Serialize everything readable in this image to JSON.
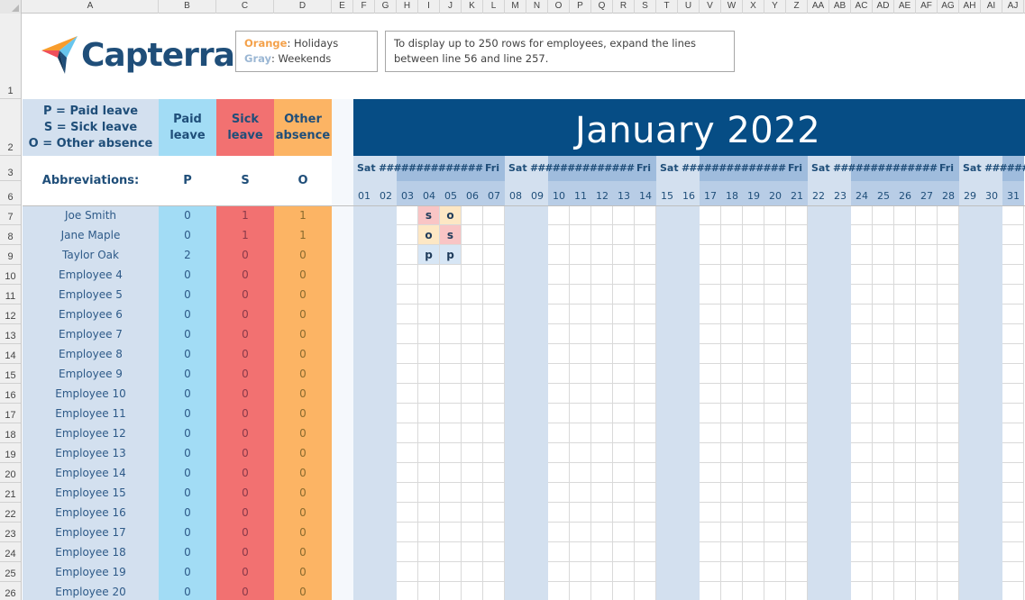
{
  "spreadsheet": {
    "columns": [
      "A",
      "B",
      "C",
      "D",
      "E",
      "F",
      "G",
      "H",
      "I",
      "J",
      "K",
      "L",
      "M",
      "N",
      "O",
      "P",
      "Q",
      "R",
      "S",
      "T",
      "U",
      "V",
      "W",
      "X",
      "Y",
      "Z",
      "AA",
      "AB",
      "AC",
      "AD",
      "AE",
      "AF",
      "AG",
      "AH",
      "AI",
      "AJ"
    ],
    "row_numbers": [
      "1",
      "2",
      "3",
      "6",
      "7",
      "8",
      "9",
      "10",
      "11",
      "12",
      "13",
      "14",
      "15",
      "16",
      "17",
      "18",
      "19",
      "20",
      "21",
      "22",
      "23",
      "24",
      "25",
      "26"
    ]
  },
  "logo": {
    "text": "Capterra",
    "colors": {
      "orange": "#f89c2c",
      "red": "#ef4f5a",
      "blue": "#68c5ed",
      "navy": "#1f4e79"
    }
  },
  "legend": {
    "orange_label": "Orange",
    "orange_desc": ": Holidays",
    "gray_label": "Gray",
    "gray_desc": ": Weekends"
  },
  "note": {
    "line1": "To display up to 250 rows for employees, expand the lines",
    "line2": "between line 56 and line 257."
  },
  "key": {
    "line1": "P = Paid leave",
    "line2": "S = Sick leave",
    "line3": "O = Other absence"
  },
  "summary_headers": {
    "paid": [
      "Paid",
      "leave"
    ],
    "sick": [
      "Sick",
      "leave"
    ],
    "other": [
      "Other",
      "absence"
    ]
  },
  "abbreviations": {
    "label": "Abbreviations:",
    "paid": "P",
    "sick": "S",
    "other": "O"
  },
  "calendar": {
    "title": "January 2022",
    "weekday_labels": {
      "sat": "Sat",
      "fri": "Fri",
      "overflow": "##############"
    },
    "days": [
      "01",
      "02",
      "03",
      "04",
      "05",
      "06",
      "07",
      "08",
      "09",
      "10",
      "11",
      "12",
      "13",
      "14",
      "15",
      "16",
      "17",
      "18",
      "19",
      "20",
      "21",
      "22",
      "23",
      "24",
      "25",
      "26",
      "27",
      "28",
      "29",
      "30",
      "31"
    ],
    "weekend_days": [
      "01",
      "02",
      "08",
      "09",
      "15",
      "16",
      "22",
      "23",
      "29",
      "30"
    ],
    "colors": {
      "header": "#064d85",
      "weekend": "#d3e0ef",
      "weekday_band": "#9fbcdd",
      "sick": "#f9c5c5",
      "other": "#fde7c4",
      "paid": "#d7e6f5"
    }
  },
  "employees": [
    {
      "row": "7",
      "name": "Joe Smith",
      "paid": "0",
      "sick": "1",
      "other": "1",
      "marks": {
        "04": "s",
        "05": "o"
      }
    },
    {
      "row": "8",
      "name": "Jane Maple",
      "paid": "0",
      "sick": "1",
      "other": "1",
      "marks": {
        "04": "o",
        "05": "s"
      }
    },
    {
      "row": "9",
      "name": "Taylor Oak",
      "paid": "2",
      "sick": "0",
      "other": "0",
      "marks": {
        "04": "p",
        "05": "p"
      }
    },
    {
      "row": "10",
      "name": "Employee 4",
      "paid": "0",
      "sick": "0",
      "other": "0",
      "marks": {}
    },
    {
      "row": "11",
      "name": "Employee 5",
      "paid": "0",
      "sick": "0",
      "other": "0",
      "marks": {}
    },
    {
      "row": "12",
      "name": "Employee 6",
      "paid": "0",
      "sick": "0",
      "other": "0",
      "marks": {}
    },
    {
      "row": "13",
      "name": "Employee 7",
      "paid": "0",
      "sick": "0",
      "other": "0",
      "marks": {}
    },
    {
      "row": "14",
      "name": "Employee 8",
      "paid": "0",
      "sick": "0",
      "other": "0",
      "marks": {}
    },
    {
      "row": "15",
      "name": "Employee 9",
      "paid": "0",
      "sick": "0",
      "other": "0",
      "marks": {}
    },
    {
      "row": "16",
      "name": "Employee 10",
      "paid": "0",
      "sick": "0",
      "other": "0",
      "marks": {}
    },
    {
      "row": "17",
      "name": "Employee 11",
      "paid": "0",
      "sick": "0",
      "other": "0",
      "marks": {}
    },
    {
      "row": "18",
      "name": "Employee 12",
      "paid": "0",
      "sick": "0",
      "other": "0",
      "marks": {}
    },
    {
      "row": "19",
      "name": "Employee 13",
      "paid": "0",
      "sick": "0",
      "other": "0",
      "marks": {}
    },
    {
      "row": "20",
      "name": "Employee 14",
      "paid": "0",
      "sick": "0",
      "other": "0",
      "marks": {}
    },
    {
      "row": "21",
      "name": "Employee 15",
      "paid": "0",
      "sick": "0",
      "other": "0",
      "marks": {}
    },
    {
      "row": "22",
      "name": "Employee 16",
      "paid": "0",
      "sick": "0",
      "other": "0",
      "marks": {}
    },
    {
      "row": "23",
      "name": "Employee 17",
      "paid": "0",
      "sick": "0",
      "other": "0",
      "marks": {}
    },
    {
      "row": "24",
      "name": "Employee 18",
      "paid": "0",
      "sick": "0",
      "other": "0",
      "marks": {}
    },
    {
      "row": "25",
      "name": "Employee 19",
      "paid": "0",
      "sick": "0",
      "other": "0",
      "marks": {}
    },
    {
      "row": "26",
      "name": "Employee 20",
      "paid": "0",
      "sick": "0",
      "other": "0",
      "marks": {}
    }
  ]
}
